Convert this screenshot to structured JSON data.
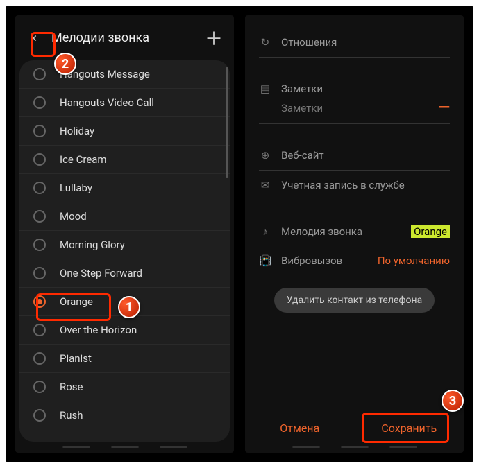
{
  "left": {
    "title": "Мелодии звонка",
    "ringtones": [
      {
        "label": "Hangouts Message",
        "selected": false
      },
      {
        "label": "Hangouts Video Call",
        "selected": false
      },
      {
        "label": "Holiday",
        "selected": false
      },
      {
        "label": "Ice Cream",
        "selected": false
      },
      {
        "label": "Lullaby",
        "selected": false
      },
      {
        "label": "Mood",
        "selected": false
      },
      {
        "label": "Morning Glory",
        "selected": false
      },
      {
        "label": "One Step Forward",
        "selected": false
      },
      {
        "label": "Orange",
        "selected": true
      },
      {
        "label": "Over the Horizon",
        "selected": false
      },
      {
        "label": "Pianist",
        "selected": false
      },
      {
        "label": "Rose",
        "selected": false
      },
      {
        "label": "Rush",
        "selected": false
      }
    ]
  },
  "right": {
    "relationship": {
      "label": "Отношения"
    },
    "notes": {
      "label": "Заметки",
      "placeholder": "Заметки"
    },
    "website": {
      "label": "Веб-сайт"
    },
    "account": {
      "label": "Учетная запись в службе"
    },
    "ringtone": {
      "label": "Мелодия звонка",
      "value": "Orange"
    },
    "vibration": {
      "label": "Вибровызов",
      "value": "По умолчанию"
    },
    "delete": "Удалить контакт из телефона",
    "cancel": "Отмена",
    "save": "Сохранить"
  },
  "callouts": {
    "one": "1",
    "two": "2",
    "three": "3"
  }
}
